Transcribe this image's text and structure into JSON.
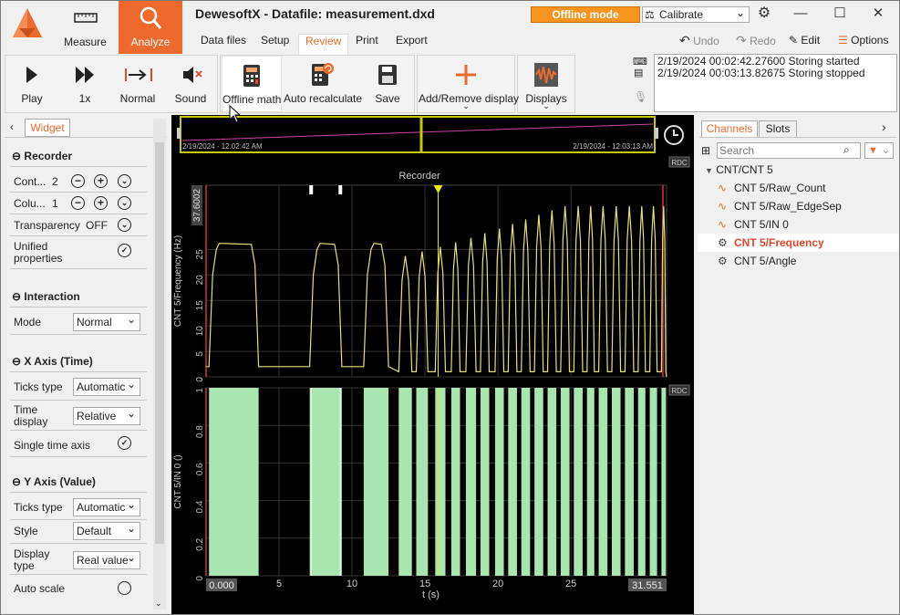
{
  "app": {
    "title": "DewesoftX - Datafile: measurement.dxd"
  },
  "modes": [
    {
      "label": "Measure"
    },
    {
      "label": "Analyze"
    }
  ],
  "menu": {
    "tabs": [
      {
        "label": "Data files"
      },
      {
        "label": "Setup"
      },
      {
        "label": "Review"
      },
      {
        "label": "Print"
      },
      {
        "label": "Export"
      }
    ]
  },
  "status": {
    "offline_label": "Offline mode",
    "calibrate_label": "Calibrate"
  },
  "toolbar": {
    "undo": "Undo",
    "redo": "Redo",
    "edit": "Edit",
    "options": "Options"
  },
  "ribbon": {
    "buttons": [
      {
        "label": "Play"
      },
      {
        "label": "1x"
      },
      {
        "label": "Normal"
      },
      {
        "label": "Sound"
      },
      {
        "label": "Offline math"
      },
      {
        "label": "Auto recalculate"
      },
      {
        "label": "Save"
      },
      {
        "label": "Add/Remove display"
      },
      {
        "label": "Displays"
      }
    ]
  },
  "log": {
    "lines": [
      "2/19/2024 00:02:42.27600 Storing started",
      "2/19/2024 00:03:13.82675 Storing stopped"
    ]
  },
  "overview": {
    "start": "2/19/2024 - 12:02:42 AM",
    "end": "2/19/2024 - 12:03:13 AM"
  },
  "widget_panel": {
    "tab": "Widget",
    "sections": {
      "recorder": {
        "title": "Recorder",
        "rows": [
          {
            "label": "Cont...",
            "value": "2"
          },
          {
            "label": "Colu...",
            "value": "1"
          }
        ],
        "transparency_label": "Transparency",
        "transparency_value": "OFF",
        "unified": "Unified properties"
      },
      "interaction": {
        "title": "Interaction",
        "mode_label": "Mode",
        "mode_value": "Normal"
      },
      "xaxis": {
        "title": "X Axis (Time)",
        "ticks_label": "Ticks type",
        "ticks_value": "Automatic",
        "time_display_label": "Time display",
        "time_display_value": "Relative",
        "single_label": "Single time axis"
      },
      "yaxis": {
        "title": "Y Axis (Value)",
        "ticks_label": "Ticks type",
        "ticks_value": "Automatic",
        "style_label": "Style",
        "style_value": "Default",
        "display_type_label": "Display type",
        "display_type_value": "Real value",
        "auto_scale_label": "Auto scale"
      }
    }
  },
  "channels_panel": {
    "tabs": [
      {
        "label": "Channels"
      },
      {
        "label": "Slots"
      }
    ],
    "search_placeholder": "Search",
    "group": "CNT/CNT 5",
    "items": [
      {
        "label": "CNT 5/Raw_Count",
        "icon": "waveform-icon"
      },
      {
        "label": "CNT 5/Raw_EdgeSep",
        "icon": "waveform-icon"
      },
      {
        "label": "CNT 5/IN 0",
        "icon": "waveform-icon"
      },
      {
        "label": "CNT 5/Frequency",
        "icon": "gear-icon",
        "selected": true
      },
      {
        "label": "CNT 5/Angle",
        "icon": "gear-icon"
      }
    ]
  },
  "colors": {
    "accent": "#ee6a2c",
    "trace": "#e6e07a",
    "digital": "#a9e5b1",
    "cursor": "#e8e800"
  },
  "chart_data": [
    {
      "type": "line",
      "title": "Recorder",
      "badge": "RDC",
      "ylabel": "CNT 5/Frequency (Hz)",
      "ylim": [
        0,
        37.6002
      ],
      "yticks": [
        "0",
        "5",
        "10",
        "15",
        "20",
        "25"
      ],
      "ymax_label": "37.6002",
      "xlim": [
        0,
        31.551
      ]
    },
    {
      "type": "area",
      "badge": "RDC",
      "ylabel": "CNT 5/IN 0 ()",
      "ylim": [
        0,
        1
      ],
      "yticks": [
        "0",
        "0.2",
        "0.4",
        "0.6",
        "0.8",
        "1"
      ],
      "xlabel": "t (s)",
      "xlim": [
        0,
        31.551
      ],
      "xticks": [
        "5",
        "10",
        "15",
        "20",
        "25"
      ],
      "x_start_label": "0.000",
      "x_end_label": "31.551",
      "high_segments": [
        [
          0.2,
          3.6
        ],
        [
          7.1,
          9.3
        ],
        [
          10.8,
          12.5
        ],
        [
          13.2,
          14.1
        ],
        [
          14.4,
          15.2
        ],
        [
          15.7,
          16.4
        ],
        [
          16.8,
          17.4
        ],
        [
          17.8,
          18.5
        ],
        [
          18.8,
          19.4
        ],
        [
          19.8,
          20.4
        ],
        [
          20.7,
          21.3
        ],
        [
          21.6,
          22.2
        ],
        [
          22.5,
          23.1
        ],
        [
          23.4,
          24.0
        ],
        [
          24.3,
          24.9
        ],
        [
          25.2,
          25.8
        ],
        [
          26.1,
          26.6
        ],
        [
          26.9,
          27.5
        ],
        [
          27.8,
          28.4
        ],
        [
          28.7,
          29.3
        ],
        [
          29.6,
          30.1
        ],
        [
          30.4,
          30.9
        ],
        [
          31.2,
          31.5
        ]
      ],
      "cursor_x": 15.9
    }
  ]
}
